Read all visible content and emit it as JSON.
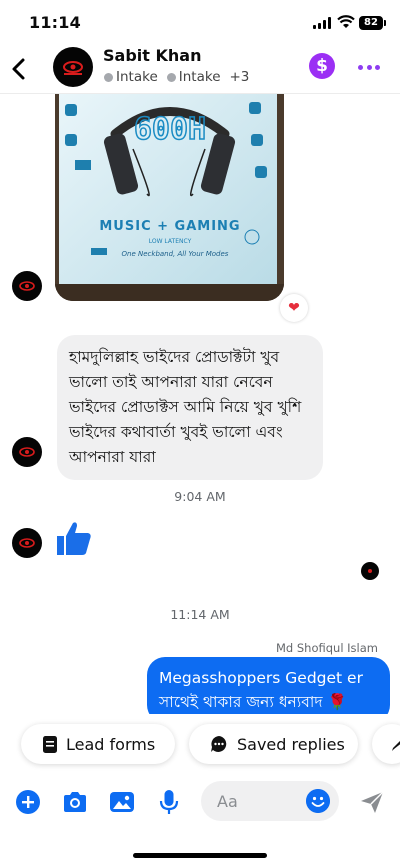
{
  "status_bar": {
    "time": "11:14",
    "battery": "82"
  },
  "header": {
    "contact_name": "Sabit Khan",
    "tags": [
      "Intake",
      "Intake"
    ],
    "more_tags": "+3",
    "payment_symbol": "$"
  },
  "photo": {
    "display_text": "600H",
    "banner": "MUSIC + GAMING",
    "sub_banner": "LOW LATENCY",
    "tagline": "One Neckband, All Your Modes"
  },
  "messages": {
    "incoming_text": "হামদুলিল্লাহ ভাইদের প্রোডাক্টটা খুব ভালো তাই আপনারা যারা নেবেন ভাইদের প্রোডাক্টস আমি নিয়ে খুব খুশি ভাইদের কথাবার্তা খুবই ভালো এবং আপনারা যারা",
    "time_1": "9:04 AM",
    "time_2": "11:14 AM",
    "sender_name": "Md Shofiqul Islam",
    "outgoing_text": "Megasshoppers Gedget er সাথেই থাকার জন্য ধন্যবাদ",
    "outgoing_emoji": "🌹"
  },
  "quick_replies": {
    "lead_forms": "Lead forms",
    "saved_replies": "Saved replies"
  },
  "composer": {
    "placeholder": "Aa"
  },
  "colors": {
    "accent": "#0d6cf2",
    "purple": "#9b2ff4",
    "bubble_in": "#f0f0f1"
  }
}
